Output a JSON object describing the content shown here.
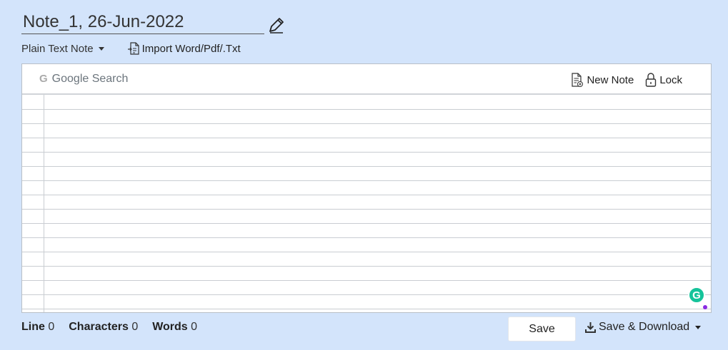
{
  "note": {
    "title": "Note_1, 26-Jun-2022"
  },
  "toolbar": {
    "note_type": "Plain Text Note",
    "import_label": "Import Word/Pdf/.Txt"
  },
  "editor": {
    "google_search_label": "Google Search",
    "new_note_label": "New Note",
    "lock_label": "Lock",
    "grammarly_badge": "G"
  },
  "footer": {
    "line_label": "Line",
    "line_value": "0",
    "characters_label": "Characters",
    "characters_value": "0",
    "words_label": "Words",
    "words_value": "0",
    "save_label": "Save",
    "save_download_label": "Save & Download"
  },
  "icons": {
    "edit": "pencil-icon",
    "import": "document-import-icon",
    "new_note": "new-note-icon",
    "lock": "lock-icon",
    "download": "download-icon"
  },
  "colors": {
    "page_background": "#d3e4fb",
    "grammarly": "#15c39a"
  }
}
